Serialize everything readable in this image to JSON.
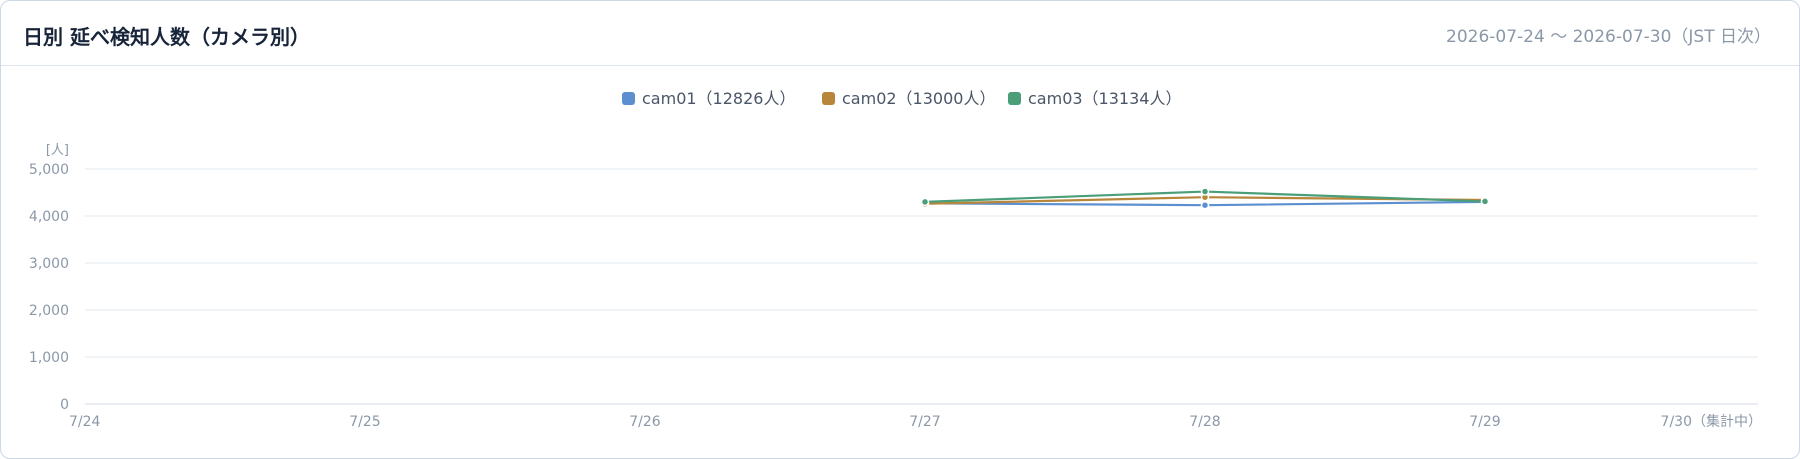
{
  "header": {
    "title": "日別 延べ検知人数（カメラ別）",
    "range": "2026-07-24 ～ 2026-07-30（JST 日次）"
  },
  "chart_data": {
    "type": "line",
    "ylabel": "[人]",
    "ylim": [
      0,
      5000
    ],
    "yticks": [
      0,
      1000,
      2000,
      3000,
      4000,
      5000
    ],
    "ytick_labels": [
      "0",
      "1,000",
      "2,000",
      "3,000",
      "4,000",
      "5,000"
    ],
    "categories": [
      "7/24",
      "7/25",
      "7/26",
      "7/27",
      "7/28",
      "7/29",
      "7/30（集計中）"
    ],
    "grid": true,
    "legend_position": "top-center",
    "series": [
      {
        "name": "cam01（12826人）",
        "color": "#5b8fd0",
        "values": [
          null,
          null,
          null,
          4270,
          4230,
          4300,
          null
        ]
      },
      {
        "name": "cam02（13000人）",
        "color": "#b8863a",
        "values": [
          null,
          null,
          null,
          4260,
          4400,
          4340,
          null
        ]
      },
      {
        "name": "cam03（13134人）",
        "color": "#4a9e78",
        "values": [
          null,
          null,
          null,
          4300,
          4520,
          4310,
          null
        ]
      }
    ]
  }
}
